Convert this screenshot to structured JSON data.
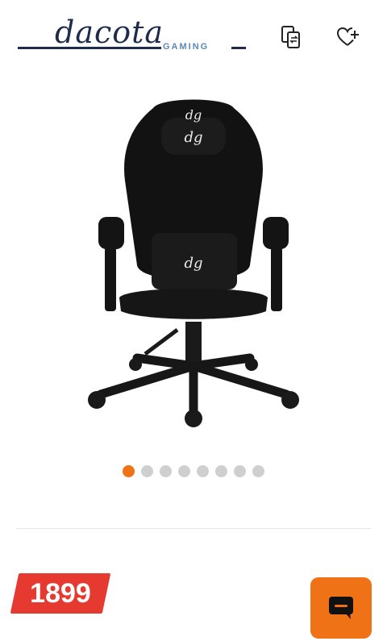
{
  "brand": {
    "name": "dacota",
    "subtitle": "GAMING"
  },
  "header": {
    "compare_icon": "compare-icon",
    "wishlist_icon": "heart-plus-icon"
  },
  "gallery": {
    "image_alt": "Black gaming chair",
    "total_slides": 8,
    "active_slide": 1
  },
  "product": {
    "price": "1899"
  },
  "chat": {
    "icon": "chat-bubble-icon"
  },
  "colors": {
    "accent": "#f07216",
    "price_badge": "#e63a31",
    "brand_navy": "#1e2b4d",
    "brand_blue": "#5d88b8"
  }
}
